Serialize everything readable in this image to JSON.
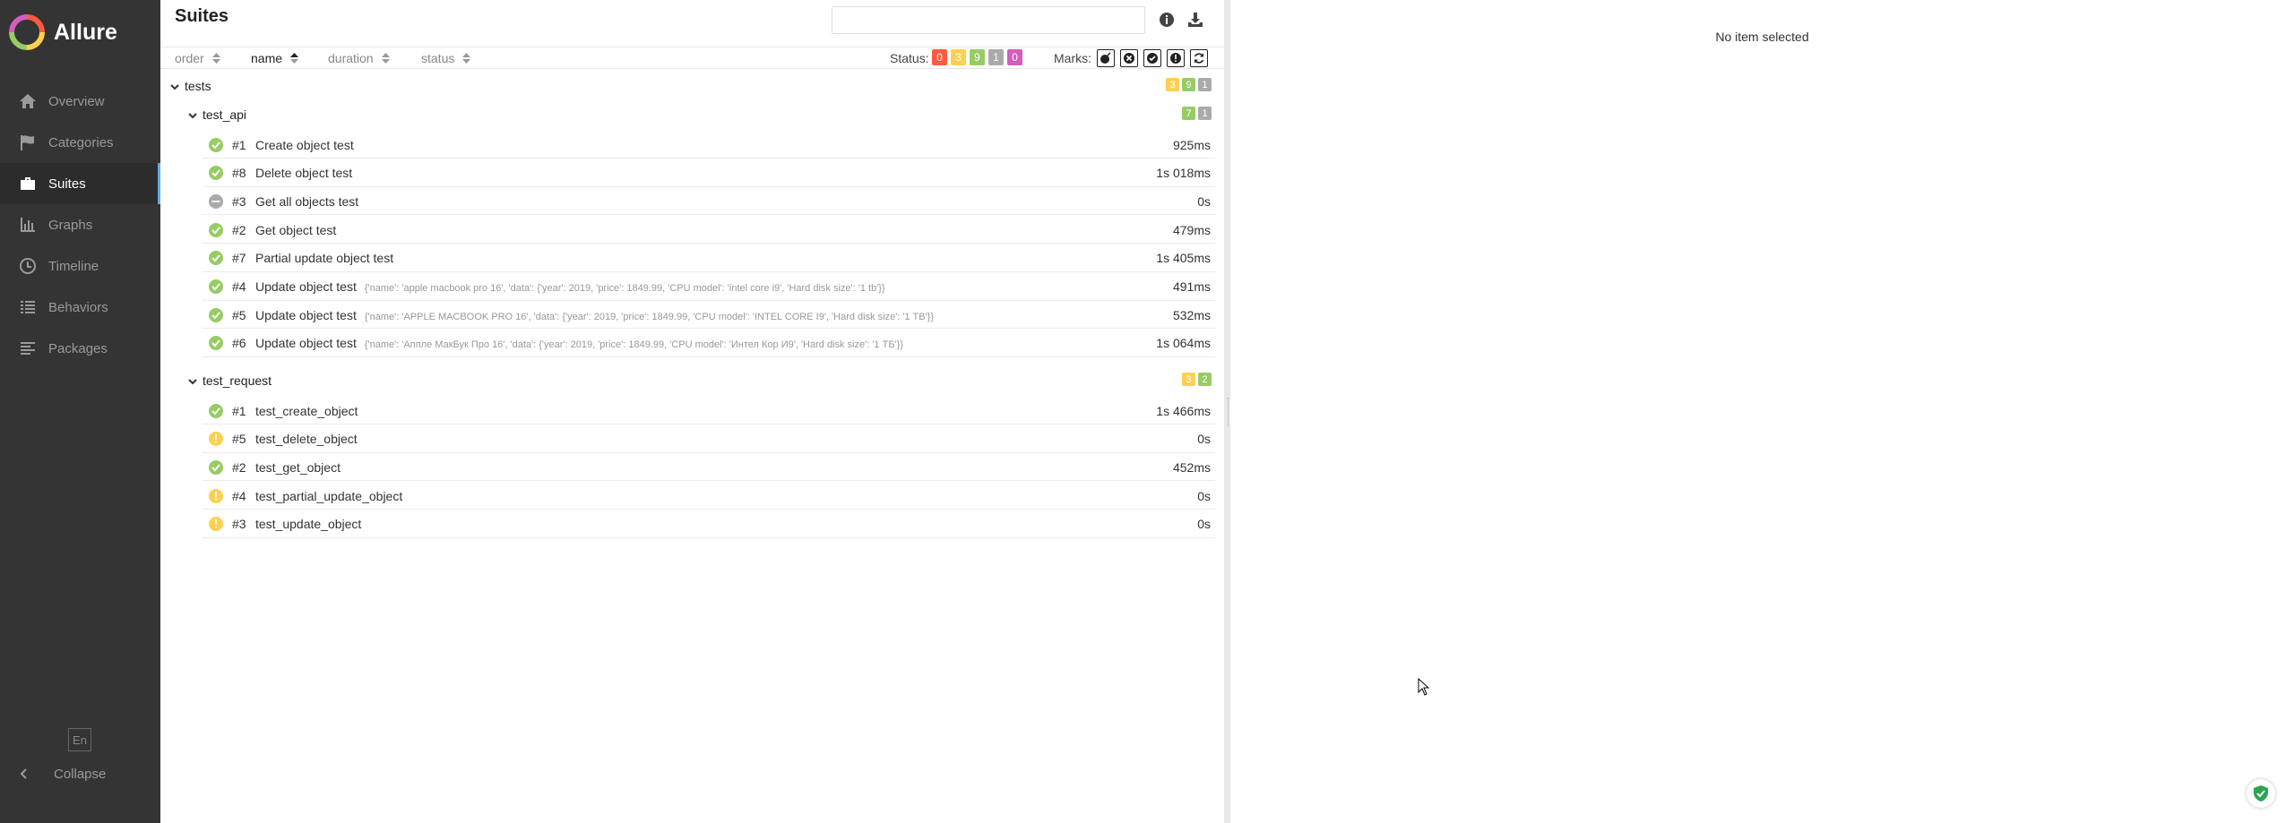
{
  "app": {
    "name": "Allure"
  },
  "sidebar": {
    "items": [
      {
        "label": "Overview",
        "icon": "home-icon"
      },
      {
        "label": "Categories",
        "icon": "flag-icon"
      },
      {
        "label": "Suites",
        "icon": "briefcase-icon",
        "active": true
      },
      {
        "label": "Graphs",
        "icon": "bar-chart-icon"
      },
      {
        "label": "Timeline",
        "icon": "clock-icon"
      },
      {
        "label": "Behaviors",
        "icon": "list-icon"
      },
      {
        "label": "Packages",
        "icon": "align-left-icon"
      }
    ],
    "language": "En",
    "collapse_label": "Collapse"
  },
  "suites": {
    "title": "Suites",
    "search_value": "",
    "sort": {
      "order": "order",
      "name": "name",
      "duration": "duration",
      "status": "status"
    },
    "status_label": "Status:",
    "status_counts": [
      {
        "value": "0",
        "color": "#fd5a3e"
      },
      {
        "value": "3",
        "color": "#ffd050"
      },
      {
        "value": "9",
        "color": "#97cc64"
      },
      {
        "value": "1",
        "color": "#aaaaaa"
      },
      {
        "value": "0",
        "color": "#d35ebe"
      }
    ],
    "marks_label": "Marks:"
  },
  "tree": {
    "root": {
      "name": "tests",
      "badges": [
        {
          "value": "3",
          "color": "#ffd050"
        },
        {
          "value": "9",
          "color": "#97cc64"
        },
        {
          "value": "1",
          "color": "#aaaaaa"
        }
      ]
    },
    "groups": [
      {
        "name": "test_api",
        "badges": [
          {
            "value": "7",
            "color": "#97cc64"
          },
          {
            "value": "1",
            "color": "#aaaaaa"
          }
        ],
        "tests": [
          {
            "num": "#1",
            "name": "Create object test",
            "params": "",
            "duration": "925ms",
            "status": "passed"
          },
          {
            "num": "#8",
            "name": "Delete object test",
            "params": "",
            "duration": "1s 018ms",
            "status": "passed"
          },
          {
            "num": "#3",
            "name": "Get all objects test",
            "params": "",
            "duration": "0s",
            "status": "skipped"
          },
          {
            "num": "#2",
            "name": "Get object test",
            "params": "",
            "duration": "479ms",
            "status": "passed"
          },
          {
            "num": "#7",
            "name": "Partial update object test",
            "params": "",
            "duration": "1s 405ms",
            "status": "passed"
          },
          {
            "num": "#4",
            "name": "Update object test",
            "params": "{'name': 'apple macbook pro 16', 'data': {'year': 2019, 'price': 1849.99, 'CPU model': 'intel core i9', 'Hard disk size': '1 tb'}}",
            "duration": "491ms",
            "status": "passed"
          },
          {
            "num": "#5",
            "name": "Update object test",
            "params": "{'name': 'APPLE MACBOOK PRO 16', 'data': {'year': 2019, 'price': 1849.99, 'CPU model': 'INTEL CORE I9', 'Hard disk size': '1 TB'}}",
            "duration": "532ms",
            "status": "passed"
          },
          {
            "num": "#6",
            "name": "Update object test",
            "params": "{'name': 'Аппле МакБук Про 16', 'data': {'year': 2019, 'price': 1849.99, 'CPU model': 'Интел Кор И9', 'Hard disk size': '1 ТБ'}}",
            "duration": "1s 064ms",
            "status": "passed"
          }
        ]
      },
      {
        "name": "test_request",
        "badges": [
          {
            "value": "3",
            "color": "#ffd050"
          },
          {
            "value": "2",
            "color": "#97cc64"
          }
        ],
        "tests": [
          {
            "num": "#1",
            "name": "test_create_object",
            "params": "",
            "duration": "1s 466ms",
            "status": "passed"
          },
          {
            "num": "#5",
            "name": "test_delete_object",
            "params": "",
            "duration": "0s",
            "status": "broken"
          },
          {
            "num": "#2",
            "name": "test_get_object",
            "params": "",
            "duration": "452ms",
            "status": "passed"
          },
          {
            "num": "#4",
            "name": "test_partial_update_object",
            "params": "",
            "duration": "0s",
            "status": "broken"
          },
          {
            "num": "#3",
            "name": "test_update_object",
            "params": "",
            "duration": "0s",
            "status": "broken"
          }
        ]
      }
    ]
  },
  "detail": {
    "empty_text": "No item selected"
  }
}
